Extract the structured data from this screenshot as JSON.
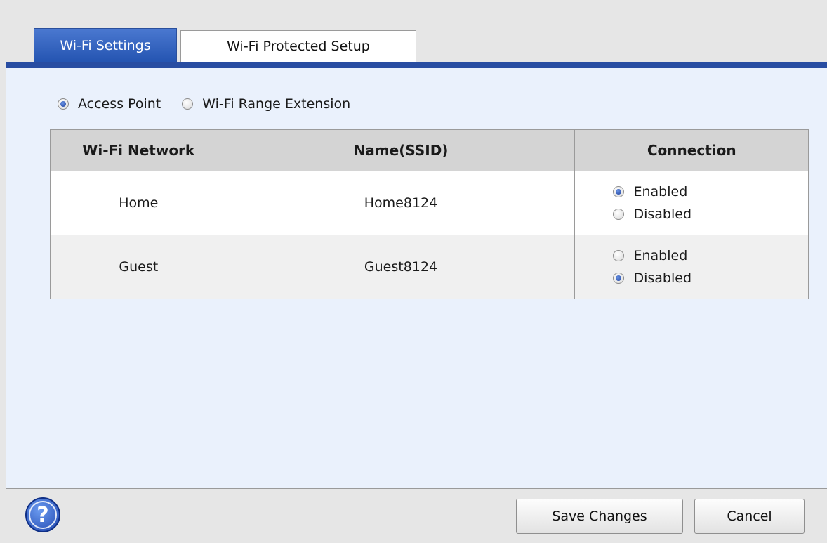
{
  "tabs": [
    {
      "label": "Wi-Fi Settings",
      "active": true
    },
    {
      "label": "Wi-Fi Protected Setup",
      "active": false
    }
  ],
  "mode": {
    "options": [
      {
        "label": "Access Point",
        "checked": true
      },
      {
        "label": "Wi-Fi Range Extension",
        "checked": false
      }
    ]
  },
  "table": {
    "headers": [
      "Wi-Fi Network",
      "Name(SSID)",
      "Connection"
    ],
    "rows": [
      {
        "network": "Home",
        "ssid": "Home8124",
        "enabled_label": "Enabled",
        "disabled_label": "Disabled",
        "connection": "Enabled"
      },
      {
        "network": "Guest",
        "ssid": "Guest8124",
        "enabled_label": "Enabled",
        "disabled_label": "Disabled",
        "connection": "Disabled"
      }
    ]
  },
  "footer": {
    "help_icon": "question-mark-icon",
    "help_glyph": "?",
    "save_label": "Save Changes",
    "cancel_label": "Cancel"
  },
  "colors": {
    "accent": "#284da2",
    "panel_bg": "#eaf1fc",
    "header_bg": "#d4d4d4"
  }
}
